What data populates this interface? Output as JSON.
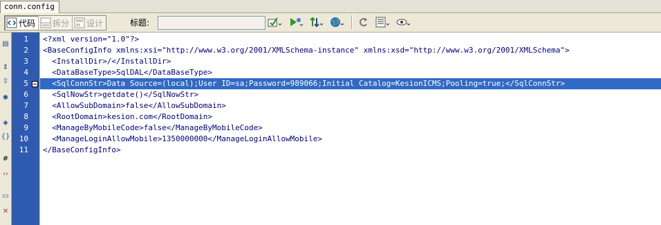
{
  "tab": {
    "label": "conn.config"
  },
  "toolbar": {
    "code_label": "代码",
    "split_label": "拆分",
    "design_label": "设计",
    "title_label": "标题:",
    "title_value": ""
  },
  "toolbar_icons": [
    "validate-icon",
    "preview-icon",
    "file-transfer-icon",
    "browser-globe-icon",
    "refresh-icon",
    "view-options-icon",
    "visual-aids-icon"
  ],
  "left_tools": [
    "open-documents-icon",
    "collapse-tag-icon",
    "collapse-selection-icon",
    "expand-all-icon",
    "select-parent-tag-icon",
    "balance-braces-icon",
    "line-numbers-icon",
    "highlight-invalid-icon",
    "apply-comment-icon",
    "remove-comment-icon"
  ],
  "editor": {
    "selected_line": 5,
    "lines": [
      {
        "n": "1",
        "text": "<?xml version=\"1.0\"?>"
      },
      {
        "n": "2",
        "text": "<BaseConfigInfo xmlns:xsi=\"http://www.w3.org/2001/XMLSchema-instance\" xmlns:xsd=\"http://www.w3.org/2001/XMLSchema\">"
      },
      {
        "n": "3",
        "text": "  <InstallDir>/</InstallDir>"
      },
      {
        "n": "4",
        "text": "  <DataBaseType>SqlDAL</DataBaseType>"
      },
      {
        "n": "5",
        "text": "  <SqlConnStr>Data Source=(local);User ID=sa;Password=989066;Initial Catalog=KesionICMS;Pooling=true;</SqlConnStr>"
      },
      {
        "n": "6",
        "text": "  <SqlNowStr>getdate()</SqlNowStr>"
      },
      {
        "n": "7",
        "text": "  <AllowSubDomain>false</AllowSubDomain>"
      },
      {
        "n": "8",
        "text": "  <RootDomain>kesion.com</RootDomain>"
      },
      {
        "n": "9",
        "text": "  <ManageByMobileCode>false</ManageByMobileCode>"
      },
      {
        "n": "10",
        "text": "  <ManageLoginAllowMobile>1350000000</ManageLoginAllowMobile>"
      },
      {
        "n": "11",
        "text": "</BaseConfigInfo>"
      }
    ]
  },
  "colors": {
    "gutter": "#2e5bb0",
    "selection": "#316ac5",
    "code_text": "#000080"
  }
}
